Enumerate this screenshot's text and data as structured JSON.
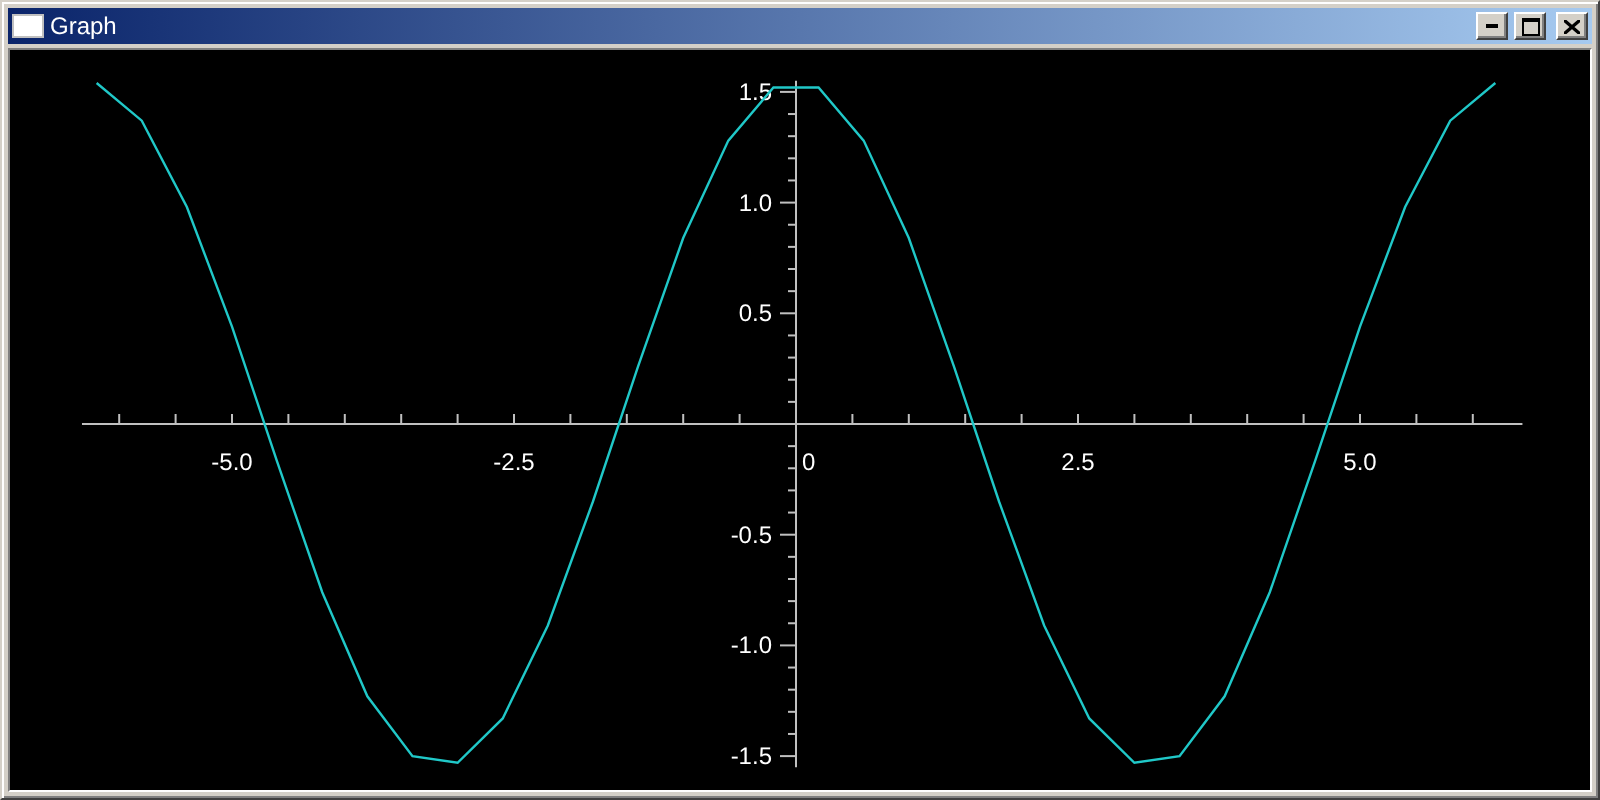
{
  "window": {
    "title": "Graph"
  },
  "chart_data": {
    "type": "line",
    "x": [
      -6.2,
      -5.8,
      -5.4,
      -5.0,
      -4.6,
      -4.2,
      -3.8,
      -3.4,
      -3.0,
      -2.6,
      -2.2,
      -1.8,
      -1.4,
      -1.0,
      -0.6,
      -0.2,
      0.2,
      0.6,
      1.0,
      1.4,
      1.8,
      2.2,
      2.6,
      3.0,
      3.4,
      3.8,
      4.2,
      4.6,
      5.0,
      5.4,
      5.8,
      6.2
    ],
    "series": [
      {
        "color": "#20c8c8",
        "values": [
          1.54,
          1.37,
          0.98,
          0.44,
          -0.17,
          -0.76,
          -1.23,
          -1.5,
          -1.53,
          -1.33,
          -0.91,
          -0.35,
          0.26,
          0.84,
          1.28,
          1.52,
          1.52,
          1.28,
          0.84,
          0.26,
          -0.35,
          -0.91,
          -1.33,
          -1.53,
          -1.5,
          -1.23,
          -0.76,
          -0.17,
          0.44,
          0.98,
          1.37,
          1.54
        ]
      }
    ],
    "xlim": [
      -6.33,
      6.44
    ],
    "ylim": [
      -1.55,
      1.55
    ],
    "xticks": [
      {
        "value": -5,
        "label": "-5.0"
      },
      {
        "value": -2.5,
        "label": "-2.5"
      },
      {
        "value": 0,
        "label": "0"
      },
      {
        "value": 2.5,
        "label": "2.5"
      },
      {
        "value": 5,
        "label": "5.0"
      }
    ],
    "yticks": [
      {
        "value": -1.5,
        "label": "-1.5"
      },
      {
        "value": -1,
        "label": "-1.0"
      },
      {
        "value": -0.5,
        "label": "-0.5"
      },
      {
        "value": 0.5,
        "label": "0.5"
      },
      {
        "value": 1,
        "label": "1.0"
      },
      {
        "value": 1.5,
        "label": "1.5"
      }
    ]
  }
}
